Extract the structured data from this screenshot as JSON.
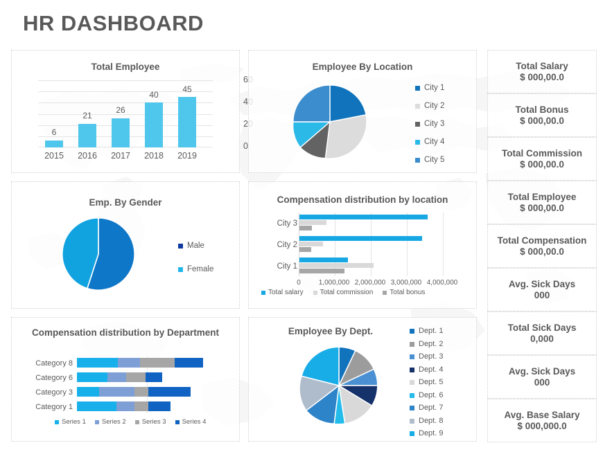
{
  "page_title": "HR DASHBOARD",
  "theme": {
    "title_color": "#595959",
    "text_color": "#5a5a5a",
    "panel_border": "#cfcfcf",
    "accent_cyan": "#4FC6EC",
    "accent_blue": "#1077C3"
  },
  "charts": {
    "total_employee": {
      "title": "Total Employee",
      "chart_data": {
        "type": "bar",
        "title": "Total Employee",
        "categories": [
          "2015",
          "2016",
          "2017",
          "2018",
          "2019"
        ],
        "values": [
          6,
          21,
          26,
          40,
          45
        ],
        "data_labels": [
          "6",
          "21",
          "26",
          "40",
          "45"
        ],
        "yticks": [
          "0",
          "20",
          "40",
          "60"
        ],
        "ylim": [
          0,
          60
        ],
        "xlabel": "",
        "ylabel": "",
        "axis_position": "right",
        "grid": true,
        "series_color": "#4FC6EC"
      }
    },
    "employee_by_location": {
      "title": "Employee By Location",
      "chart_data": {
        "type": "pie",
        "title": "Employee By Location",
        "categories": [
          "City 1",
          "City 2",
          "City 3",
          "City 4",
          "City 5"
        ],
        "values": [
          28,
          24,
          13,
          10,
          25
        ],
        "colors": [
          "#1073BC",
          "#DCDCDC",
          "#636363",
          "#2BB9E8",
          "#3C8DCE"
        ],
        "legend_position": "right"
      }
    },
    "emp_by_gender": {
      "title": "Emp. By Gender",
      "chart_data": {
        "type": "pie",
        "title": "Emp. By Gender",
        "categories": [
          "Male",
          "Female"
        ],
        "values": [
          55,
          45
        ],
        "colors": [
          "#0F77C8",
          "#11A3E0"
        ],
        "legend_position": "right"
      }
    },
    "compensation_by_location": {
      "title": "Compensation distribution by location",
      "chart_data": {
        "type": "bar",
        "orientation": "horizontal",
        "title": "Compensation distribution by location",
        "categories": [
          "City 1",
          "City 2",
          "City 3"
        ],
        "series": [
          {
            "name": "Total salary",
            "values": [
              1350000,
              3400000,
              3550000
            ],
            "color": "#17A8E3"
          },
          {
            "name": "Total commission",
            "values": [
              2050000,
              650000,
              750000
            ],
            "color": "#D9D9D9"
          },
          {
            "name": "Total bonus",
            "values": [
              1250000,
              320000,
              350000
            ],
            "color": "#A6A6A6"
          }
        ],
        "xticks": [
          "0",
          "1,000,000",
          "2,000,000",
          "3,000,000",
          "4,000,000"
        ],
        "xlim": [
          0,
          4000000
        ],
        "grid": true,
        "legend_position": "bottom"
      }
    },
    "compensation_by_department": {
      "title": "Compensation distribution by Department",
      "chart_data": {
        "type": "bar",
        "orientation": "horizontal",
        "stacked": true,
        "title": "Compensation distribution by Department",
        "categories": [
          "Category 8",
          "Category 6",
          "Category 3",
          "Category 1"
        ],
        "series": [
          {
            "name": "Series 1",
            "values": [
              29,
              22,
              16,
              28
            ],
            "color": "#18B0EA"
          },
          {
            "name": "Series 2",
            "values": [
              16,
              13,
              25,
              13
            ],
            "color": "#7E9FD6"
          },
          {
            "name": "Series 3",
            "values": [
              25,
              14,
              10,
              10
            ],
            "color": "#A6A6A6"
          },
          {
            "name": "Series 4",
            "values": [
              20,
              12,
              30,
              16
            ],
            "color": "#1063C2"
          }
        ],
        "legend_position": "bottom"
      }
    },
    "employee_by_dept": {
      "title": "Employee By Dept.",
      "chart_data": {
        "type": "pie",
        "title": "Employee By Dept.",
        "categories": [
          "Dept. 1",
          "Dept. 2",
          "Dept. 3",
          "Dept. 4",
          "Dept. 5",
          "Dept. 6",
          "Dept. 7",
          "Dept. 8",
          "Dept. 9"
        ],
        "values": [
          7,
          11,
          7,
          6,
          12,
          9,
          14,
          13,
          21
        ],
        "colors": [
          "#1273BD",
          "#9C9C9C",
          "#4A90D2",
          "#16326B",
          "#D9D9D9",
          "#22BBEA",
          "#2E84C8",
          "#AFBCCB",
          "#19ADE7"
        ],
        "legend_position": "right"
      }
    }
  },
  "kpis": [
    {
      "label": "Total Salary",
      "value": "$ 000,00.0"
    },
    {
      "label": "Total Bonus",
      "value": "$ 000,00.0"
    },
    {
      "label": "Total Commission",
      "value": "$ 000,00.0"
    },
    {
      "label": "Total Employee",
      "value": "$ 000,00.0"
    },
    {
      "label": "Total Compensation",
      "value": "$ 000,00.0"
    },
    {
      "label": "Avg. Sick Days",
      "value": "000"
    },
    {
      "label": "Total Sick Days",
      "value": "0,000"
    },
    {
      "label": "Avg. Sick Days",
      "value": "000"
    },
    {
      "label": "Avg. Base Salary",
      "value": "$ 000,000.0"
    }
  ]
}
